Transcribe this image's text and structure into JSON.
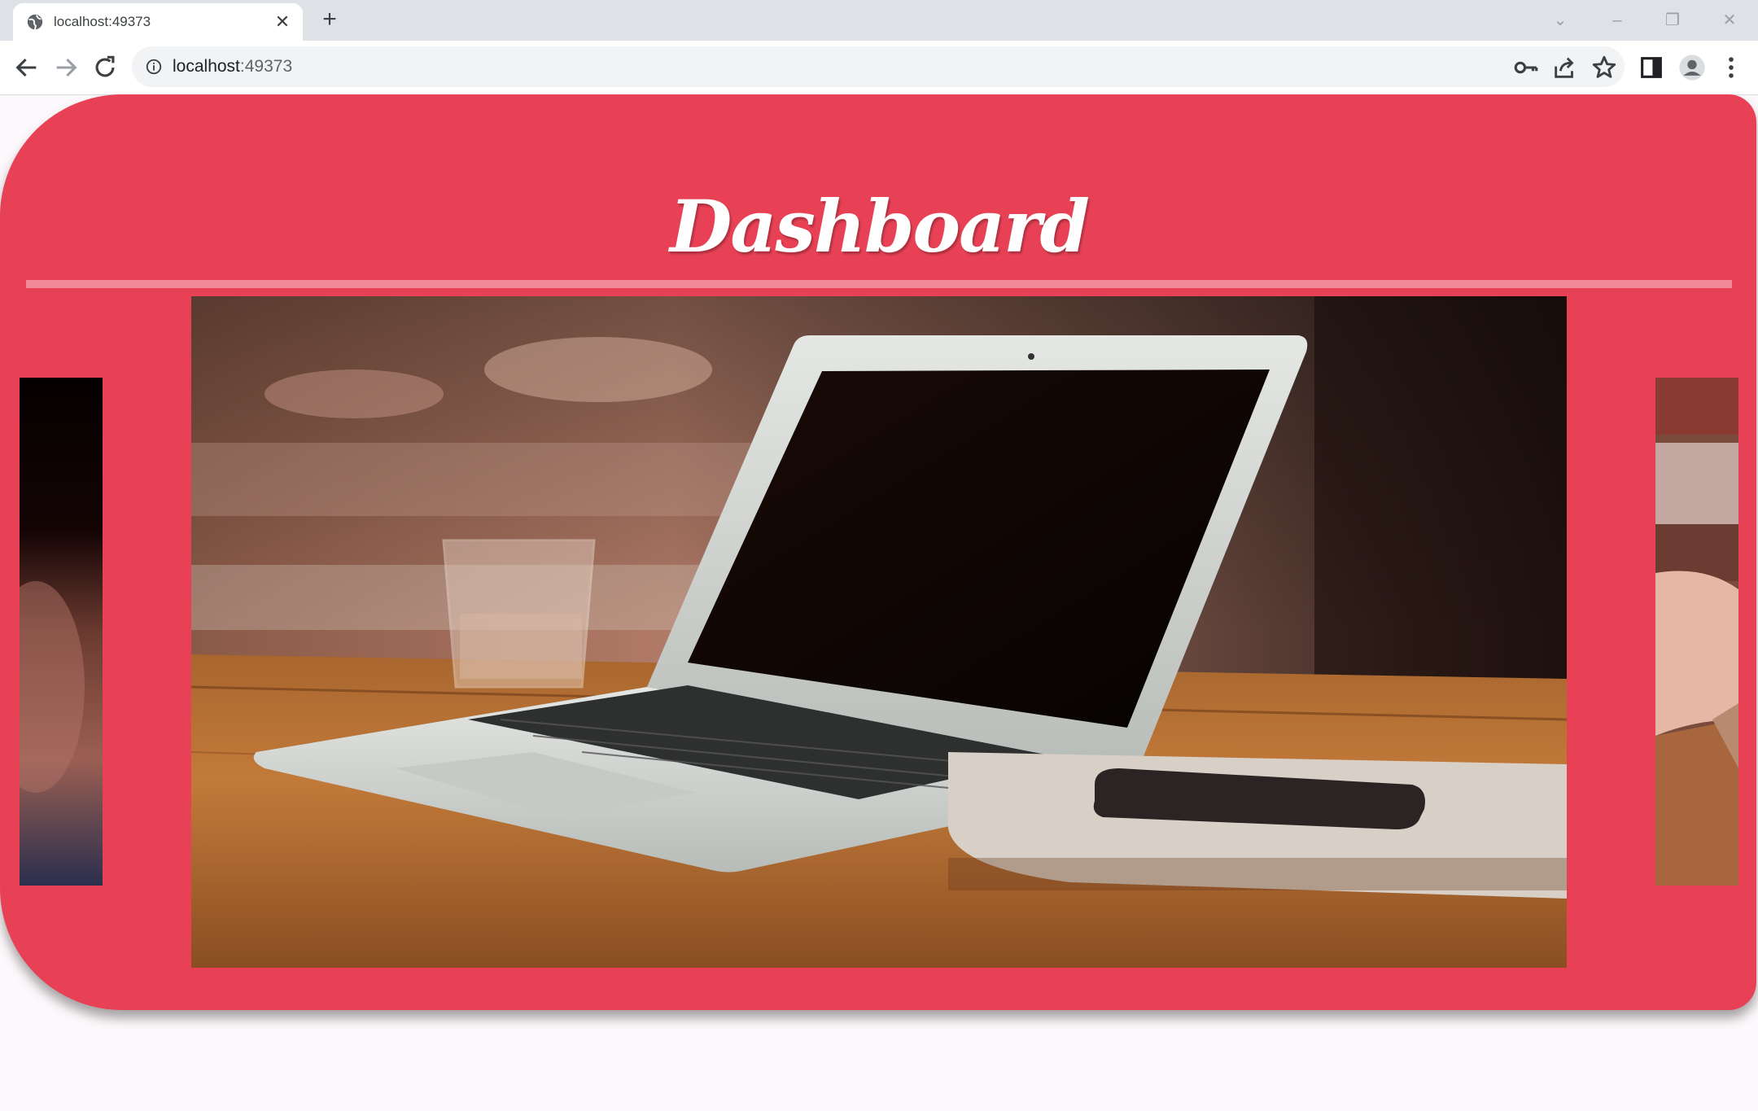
{
  "browser": {
    "tab_title": "localhost:49373",
    "url_host": "localhost",
    "url_port": ":49373",
    "icons": [
      "globe-icon",
      "close-icon",
      "plus-icon",
      "chevron-down-icon",
      "minimize-icon",
      "restore-icon",
      "window-close-icon",
      "back-icon",
      "forward-icon",
      "reload-icon",
      "info-icon",
      "key-icon",
      "share-icon",
      "star-icon",
      "side-panel-icon",
      "profile-icon",
      "menu-icon"
    ]
  },
  "page": {
    "title": "Dashboard",
    "accent_color": "#e84155",
    "divider_color": "#f08a98",
    "carousel": {
      "slides": [
        "left-partial-photo",
        "laptop-desk-photo",
        "right-partial-photo"
      ],
      "active_slide": "laptop-desk-photo"
    }
  }
}
